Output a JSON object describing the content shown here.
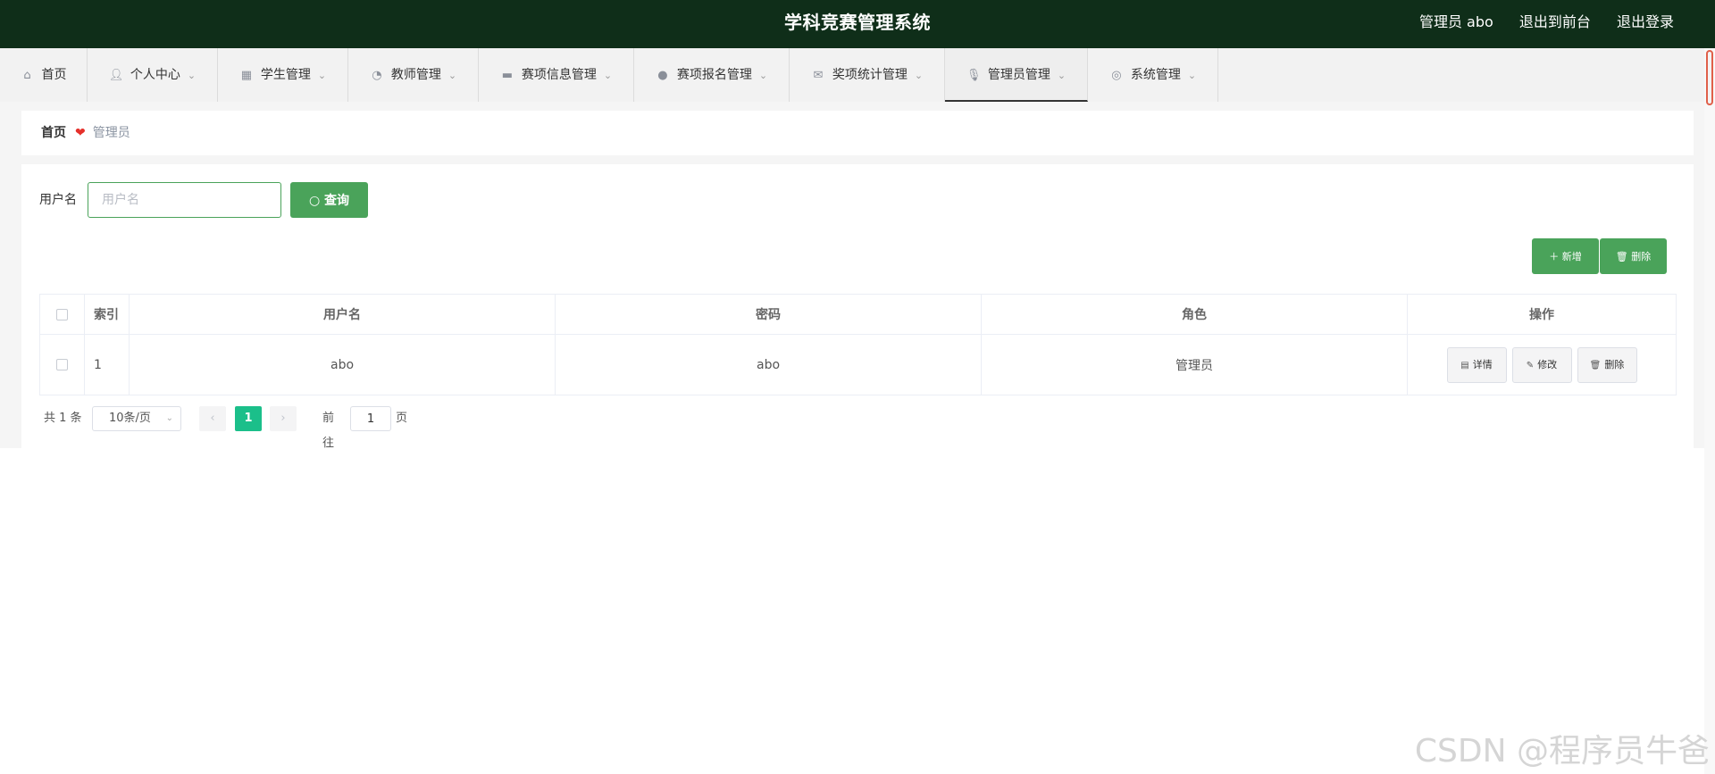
{
  "header": {
    "title": "学科竞赛管理系统",
    "user_label": "管理员 abo",
    "to_front_label": "退出到前台",
    "logout_label": "退出登录"
  },
  "nav": {
    "items": [
      {
        "label": "首页",
        "icon": "home-icon"
      },
      {
        "label": "个人中心",
        "icon": "user-icon"
      },
      {
        "label": "学生管理",
        "icon": "grid-icon"
      },
      {
        "label": "教师管理",
        "icon": "gauge-icon"
      },
      {
        "label": "赛项信息管理",
        "icon": "chat-icon"
      },
      {
        "label": "赛项报名管理",
        "icon": "balloon-icon"
      },
      {
        "label": "奖项统计管理",
        "icon": "mail-icon"
      },
      {
        "label": "管理员管理",
        "icon": "microphone-icon"
      },
      {
        "label": "系统管理",
        "icon": "compass-icon"
      }
    ],
    "active": "管理员管理"
  },
  "breadcrumb": {
    "home": "首页",
    "current": "管理员"
  },
  "search": {
    "label": "用户名",
    "placeholder": "用户名",
    "value": "",
    "button_label": "查询"
  },
  "toolbar": {
    "add_label": "新增",
    "delete_label": "删除"
  },
  "table": {
    "headers": [
      "索引",
      "用户名",
      "密码",
      "角色",
      "操作"
    ],
    "rows": [
      {
        "index": "1",
        "username": "abo",
        "password": "abo",
        "role": "管理员"
      }
    ],
    "row_actions": {
      "detail": "详情",
      "edit": "修改",
      "delete": "删除"
    }
  },
  "pagination": {
    "total_text": "共 1 条",
    "page_size": "10条/页",
    "current_page": "1",
    "goto_prefix": "前往",
    "goto_value": "1",
    "goto_suffix": "页"
  },
  "watermark": "CSDN @程序员牛爸",
  "colors": {
    "header_bg": "#0f2e19",
    "primary_green": "#4aa35a",
    "page_active": "#1bbf8a",
    "heart": "#e5302b"
  }
}
